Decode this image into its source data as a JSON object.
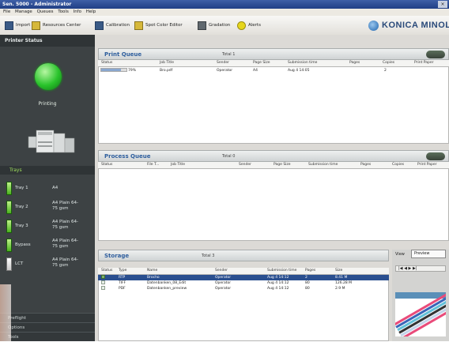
{
  "window": {
    "title": "Sen. 5000 - Administrator",
    "close_glyph": "×"
  },
  "menu": [
    "File",
    "Manage",
    "Queues",
    "Tools",
    "Info",
    "Help"
  ],
  "toolbar": {
    "items": [
      {
        "label": "Import",
        "icon": "import-icon"
      },
      {
        "label": "Resources Center",
        "icon": "resources-icon"
      },
      {
        "label": "Calibration",
        "icon": "calibration-icon"
      },
      {
        "label": "Spot Color Editor",
        "icon": "spot-color-icon"
      },
      {
        "label": "Gradation",
        "icon": "gradation-icon"
      },
      {
        "label": "Alerts",
        "icon": "alert-icon"
      }
    ],
    "logo": "KONICA MINOLTA"
  },
  "sidebar": {
    "header": "Printer Status",
    "status_label": "Printing",
    "status_color": "#29c32b",
    "trays_header": "Trays",
    "trays": [
      {
        "name": "Tray 1",
        "info": "A4"
      },
      {
        "name": "Tray 2",
        "info": "A4 Plain 64-\n75 gsm"
      },
      {
        "name": "Tray 3",
        "info": "A4 Plain 64-\n75 gsm"
      },
      {
        "name": "Bypass",
        "info": "A4 Plain 64-\n75 gsm"
      },
      {
        "name": "LCT",
        "info": "A4 Plain 64-\n75 gsm"
      }
    ],
    "bottom": [
      "Preflight",
      "Options",
      "Tools"
    ]
  },
  "print_queue": {
    "title": "Print Queue",
    "total": "Total 1",
    "columns": [
      "Status",
      "Job Title",
      "Sender",
      "Page Size",
      "Submission time",
      "Pages",
      "Copies",
      "Print Paper"
    ],
    "rows": [
      {
        "status": "79%",
        "progress": 0.79,
        "title": "Bro.pdf",
        "sender": "Operator",
        "size": "A4",
        "time": "Aug 4 14:05",
        "pages": "",
        "copies": "2",
        "paper": ""
      }
    ]
  },
  "process_queue": {
    "title": "Process Queue",
    "total": "Total 0",
    "columns": [
      "Status",
      "File T...",
      "Job Title",
      "Sender",
      "Page Size",
      "Submission time",
      "Pages",
      "Copies",
      "Print Paper"
    ]
  },
  "storage": {
    "title": "Storage",
    "total": "Total 3",
    "columns": [
      "Status",
      "Type",
      "Name",
      "Sender",
      "Submission time",
      "Pages",
      "Size"
    ],
    "rows": [
      {
        "type": "RTP",
        "name": "Brocho",
        "sender": "Operator",
        "time": "Aug 4 14:12",
        "pages": "2",
        "size": "8.41 M",
        "selected": true
      },
      {
        "type": "TIFF",
        "name": "Datenbanken_08_Edit",
        "sender": "Operator",
        "time": "Aug 4 14:12",
        "pages": "80",
        "size": "126.28 M",
        "selected": false
      },
      {
        "type": "PDF",
        "name": "Datenbanken_preview",
        "sender": "Operator",
        "time": "Aug 4 14:12",
        "pages": "80",
        "size": "2.9 M",
        "selected": false
      }
    ],
    "view_label": "View",
    "view_value": "Preview",
    "nav": "|◀  ◀  ▶  ▶|"
  }
}
